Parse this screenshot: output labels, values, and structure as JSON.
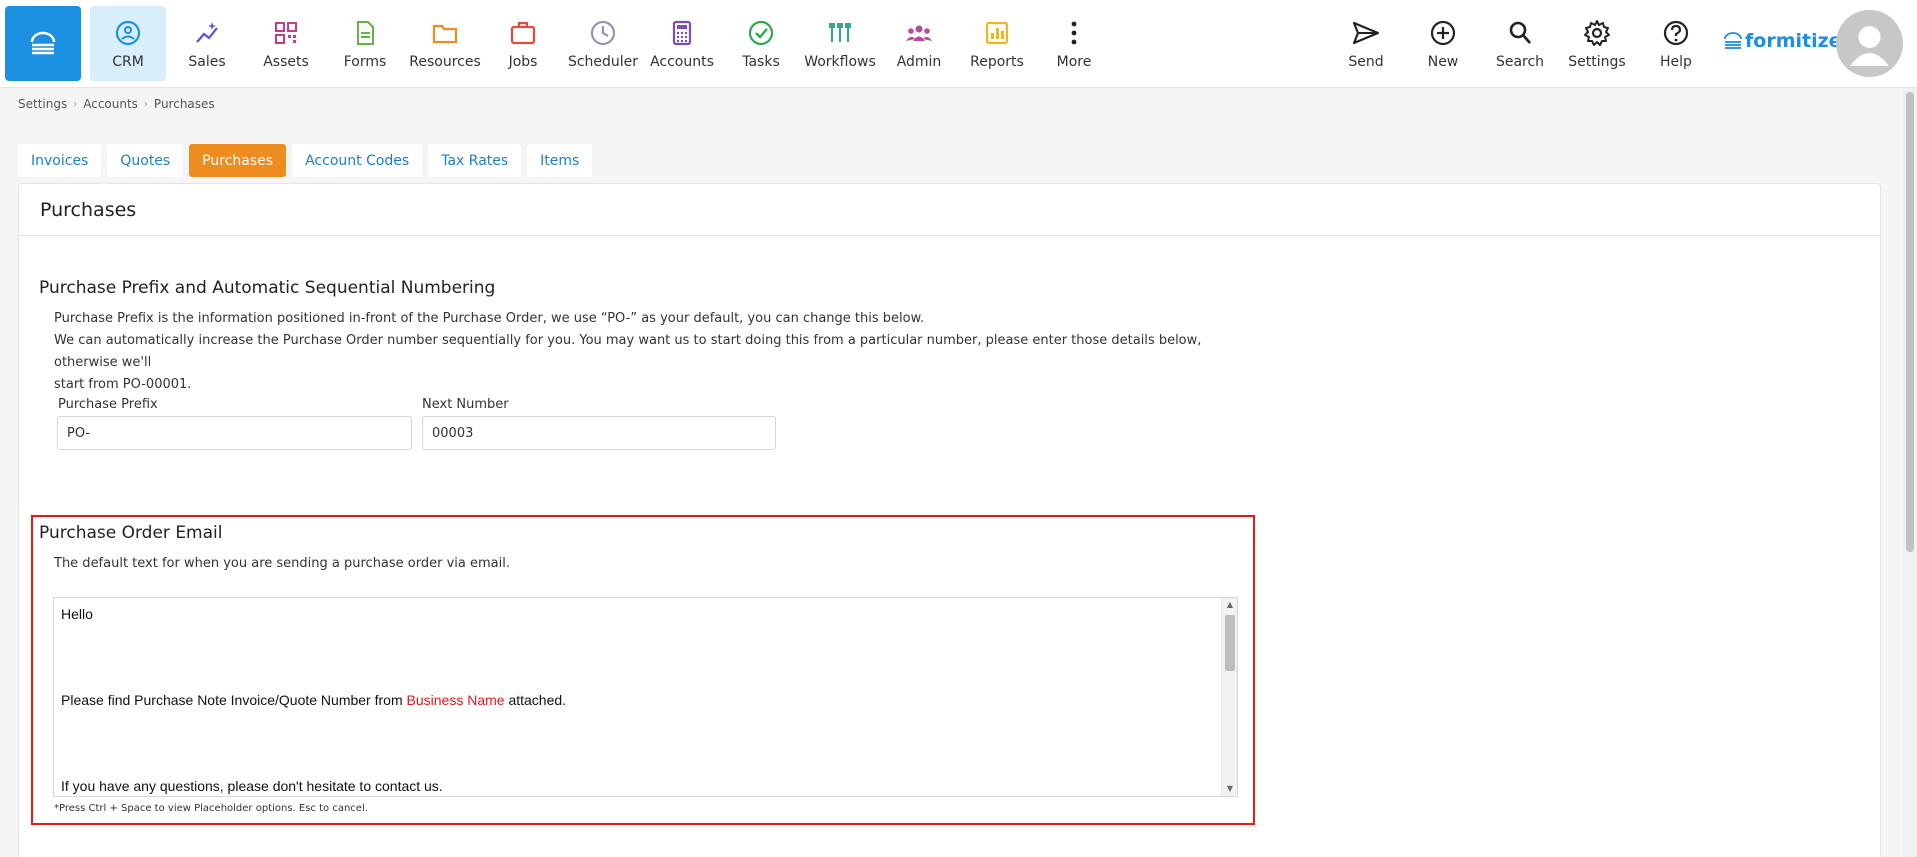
{
  "nav": {
    "home_icon": "stack-icon",
    "left_items": [
      {
        "label": "CRM",
        "icon": "smiley-icon",
        "color": "#1b8fe0"
      },
      {
        "label": "Sales",
        "icon": "sparkle-chart-icon",
        "color": "#5b4fd6"
      },
      {
        "label": "Assets",
        "icon": "qr-code-icon",
        "color": "#c43d8a"
      },
      {
        "label": "Forms",
        "icon": "document-icon",
        "color": "#5fb548"
      },
      {
        "label": "Resources",
        "icon": "folder-icon",
        "color": "#ef8c1f"
      },
      {
        "label": "Jobs",
        "icon": "briefcase-icon",
        "color": "#e44b3c"
      },
      {
        "label": "Scheduler",
        "icon": "clock-icon",
        "color": "#9a8fb8"
      },
      {
        "label": "Accounts",
        "icon": "calculator-icon",
        "color": "#7b4bb8"
      },
      {
        "label": "Tasks",
        "icon": "check-circle-icon",
        "color": "#2aa84a"
      },
      {
        "label": "Workflows",
        "icon": "workflow-icon",
        "color": "#36a88c"
      },
      {
        "label": "Admin",
        "icon": "users-icon",
        "color": "#b9489a"
      },
      {
        "label": "Reports",
        "icon": "bar-chart-icon",
        "color": "#f2b61c"
      },
      {
        "label": "More",
        "icon": "more-vertical-icon",
        "color": "#222222"
      }
    ],
    "right_items": [
      {
        "label": "Send",
        "icon": "send-icon"
      },
      {
        "label": "New",
        "icon": "plus-circle-icon"
      },
      {
        "label": "Search",
        "icon": "search-icon"
      },
      {
        "label": "Settings",
        "icon": "gear-icon"
      },
      {
        "label": "Help",
        "icon": "help-icon"
      }
    ],
    "brand": "formitize",
    "accent": "#1b8fe0"
  },
  "breadcrumb": [
    "Settings",
    "Accounts",
    "Purchases"
  ],
  "tabs": [
    {
      "label": "Invoices",
      "active": false
    },
    {
      "label": "Quotes",
      "active": false
    },
    {
      "label": "Purchases",
      "active": true
    },
    {
      "label": "Account Codes",
      "active": false
    },
    {
      "label": "Tax Rates",
      "active": false
    },
    {
      "label": "Items",
      "active": false
    }
  ],
  "panel": {
    "title": "Purchases",
    "prefix_section": {
      "title": "Purchase Prefix and Automatic Sequential Numbering",
      "desc_line1": "Purchase Prefix is the information positioned in-front of the Purchase Order, we use “PO-” as your default, you can change this below.",
      "desc_line2": "We can automatically increase the Purchase Order number sequentially for you. You may want us to start doing this from a particular number, please enter those details below, otherwise we'll",
      "desc_line3": "start from PO-00001.",
      "prefix_label": "Purchase Prefix",
      "prefix_value": "PO-",
      "next_label": "Next Number",
      "next_value": "00003"
    },
    "email_section": {
      "title": "Purchase Order Email",
      "desc": "The default text for when you are sending a purchase order via email.",
      "line_hello": "Hello",
      "line_find_before": "Please find Purchase Note Invoice/Quote Number from ",
      "line_find_token": "Business Name",
      "line_find_after": " attached.",
      "line_questions": "If you have any questions, please don't hesitate to contact us.",
      "hint": "*Press Ctrl + Space to view Placeholder options. Esc to cancel."
    }
  }
}
